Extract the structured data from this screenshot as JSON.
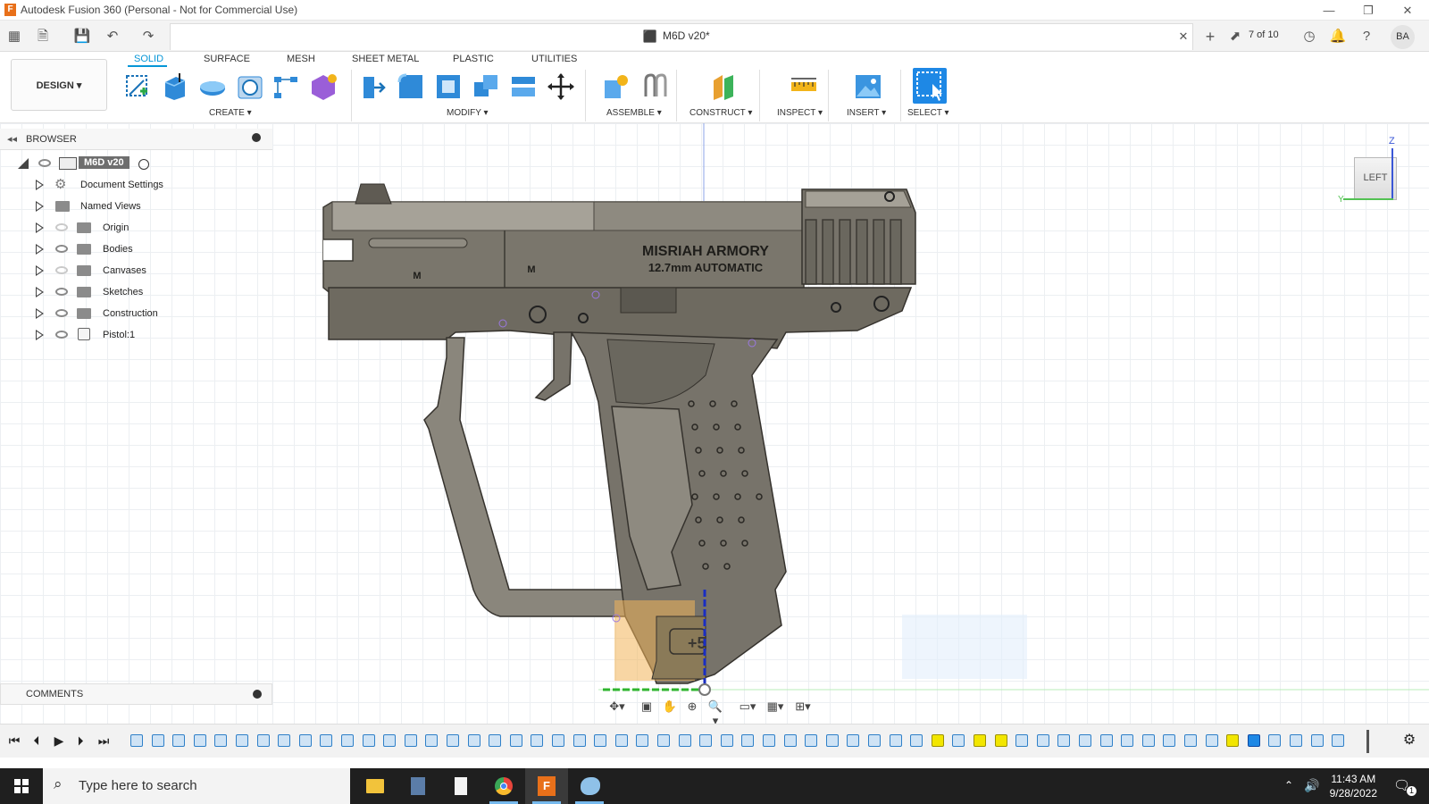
{
  "window": {
    "title": "Autodesk Fusion 360 (Personal - Not for Commercial Use)",
    "app_icon": "F"
  },
  "document": {
    "title": "M6D v20*",
    "version_count": "7 of 10",
    "user_initials": "BA"
  },
  "workspace": {
    "label": "DESIGN ▾"
  },
  "ribbon_tabs": [
    {
      "label": "SOLID",
      "active": true
    },
    {
      "label": "SURFACE"
    },
    {
      "label": "MESH"
    },
    {
      "label": "SHEET METAL"
    },
    {
      "label": "PLASTIC"
    },
    {
      "label": "UTILITIES"
    }
  ],
  "groups": {
    "create": "CREATE ▾",
    "modify": "MODIFY ▾",
    "assemble": "ASSEMBLE ▾",
    "construct": "CONSTRUCT ▾",
    "inspect": "INSPECT ▾",
    "insert": "INSERT ▾",
    "select": "SELECT ▾"
  },
  "browser": {
    "header": "BROWSER",
    "root": "M6D v20",
    "items": [
      {
        "label": "Document Settings",
        "icon": "gear-icon",
        "visible": null
      },
      {
        "label": "Named Views",
        "icon": "folder-icon",
        "visible": null
      },
      {
        "label": "Origin",
        "icon": "folder-icon",
        "visible": false
      },
      {
        "label": "Bodies",
        "icon": "folder-icon",
        "visible": true
      },
      {
        "label": "Canvases",
        "icon": "folder-icon",
        "visible": false
      },
      {
        "label": "Sketches",
        "icon": "folder-icon",
        "visible": true
      },
      {
        "label": "Construction",
        "icon": "folder-icon",
        "visible": true
      },
      {
        "label": "Pistol:1",
        "icon": "component-icon",
        "visible": true
      }
    ]
  },
  "comments": {
    "label": "COMMENTS"
  },
  "model": {
    "engraving_line1": "MISRIAH ARMORY",
    "engraving_line2": "12.7mm AUTOMATIC",
    "logo_letter": "M",
    "mag_badge": "+5"
  },
  "viewcube": {
    "face": "LEFT",
    "axis_z": "Z",
    "axis_y": "Y"
  },
  "taskbar": {
    "search_placeholder": "Type here to search",
    "time": "11:43 AM",
    "date": "9/28/2022",
    "notification_count": "1"
  },
  "colors": {
    "accent": "#0696d7",
    "model_dark": "#6e6a60",
    "model_light": "#8c887e",
    "highlight": "#f2b45a"
  }
}
